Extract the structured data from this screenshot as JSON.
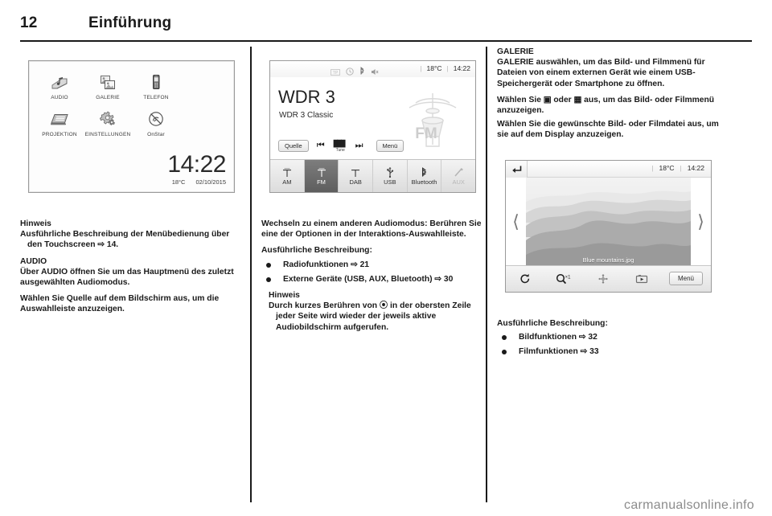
{
  "header": {
    "page_number": "12",
    "chapter": "Einführung"
  },
  "watermark": "carmanualsonline.info",
  "home_screen": {
    "apps": [
      {
        "label": "AUDIO",
        "icon": "audio-icon"
      },
      {
        "label": "GALERIE",
        "icon": "gallery-icon"
      },
      {
        "label": "TELEFON",
        "icon": "phone-icon"
      },
      {
        "label": "PROJEKTION",
        "icon": "projection-icon"
      },
      {
        "label": "EINSTELLUNGEN",
        "icon": "settings-gears-icon"
      },
      {
        "label": "OnStar",
        "icon": "onstar-icon"
      }
    ],
    "time": "14:22",
    "temperature": "18°C",
    "date": "02/10/2015"
  },
  "radio_screen": {
    "status_icons": [
      "tp-icon",
      "timer-icon",
      "bluetooth-icon",
      "mute-icon"
    ],
    "temperature": "18°C",
    "time": "14:22",
    "station_name": "WDR 3",
    "station_info": "WDR 3 Classic",
    "band_logo": "FM",
    "controls": {
      "source_label": "Quelle",
      "prev_icon": "skip-previous-icon",
      "tune_label": "Tune",
      "next_icon": "skip-next-icon",
      "menu_label": "Menü"
    },
    "tabs": [
      {
        "label": "AM",
        "icon": "antenna-icon",
        "active": false,
        "dimmed": false
      },
      {
        "label": "FM",
        "icon": "antenna-icon",
        "active": true,
        "dimmed": false
      },
      {
        "label": "DAB",
        "icon": "antenna-icon",
        "active": false,
        "dimmed": false
      },
      {
        "label": "USB",
        "icon": "usb-icon",
        "active": false,
        "dimmed": false
      },
      {
        "label": "Bluetooth",
        "icon": "bluetooth-icon",
        "active": false,
        "dimmed": false
      },
      {
        "label": "AUX",
        "icon": "aux-jack-icon",
        "active": false,
        "dimmed": true
      }
    ]
  },
  "gallery_screen": {
    "back_icon": "back-arrow-icon",
    "temperature": "18°C",
    "time": "14:22",
    "prev_icon": "chevron-left-icon",
    "next_icon": "chevron-right-icon",
    "photo_caption": "Blue mountains.jpg",
    "tools": [
      {
        "name": "rotate-icon",
        "label": ""
      },
      {
        "name": "zoom-icon",
        "label": "×1"
      },
      {
        "name": "pan-icon",
        "label": ""
      },
      {
        "name": "slideshow-icon",
        "label": ""
      }
    ],
    "menu_label": "Menü"
  },
  "columns": {
    "left": {
      "note_heading": "Hinweis",
      "note_text": "Ausführliche Beschreibung der Menübedienung über den Touchscreen ⇨ 14.",
      "audio_heading": "AUDIO",
      "audio_p1": "Über AUDIO öffnen Sie um das Hauptmenü des zuletzt ausgewählten Audiomodus.",
      "audio_p2": "Wählen Sie Quelle auf dem Bildschirm aus, um die Auswahlleiste anzuzeigen."
    },
    "middle": {
      "p1": "Wechseln zu einem anderen Audiomodus: Berühren Sie eine der Optionen in der Interaktions-Auswahlleiste.",
      "p2": "Ausführliche Beschreibung:",
      "items": [
        "Radiofunktionen ⇨ 21",
        "Externe Geräte (USB, AUX, Bluetooth) ⇨ 30"
      ],
      "note_heading": "Hinweis",
      "note_text": "Durch kurzes Berühren von ⦿ in der obersten Zeile jeder Seite wird wieder der jeweils aktive Audiobildschirm aufgerufen."
    },
    "right": {
      "heading": "GALERIE",
      "p1": "GALERIE auswählen, um das Bild- und Filmmenü für Dateien von einem externen Gerät wie einem USB-Speichergerät oder Smartphone zu öffnen.",
      "p2": "Wählen Sie ▣ oder ▦ aus, um das Bild- oder Filmmenü anzuzeigen.",
      "p3": "Wählen Sie die gewünschte Bild- oder Filmdatei aus, um sie auf dem Display anzuzeigen.",
      "p4": "Ausführliche Beschreibung:",
      "items": [
        "Bildfunktionen ⇨ 32",
        "Filmfunktionen ⇨ 33"
      ]
    }
  }
}
